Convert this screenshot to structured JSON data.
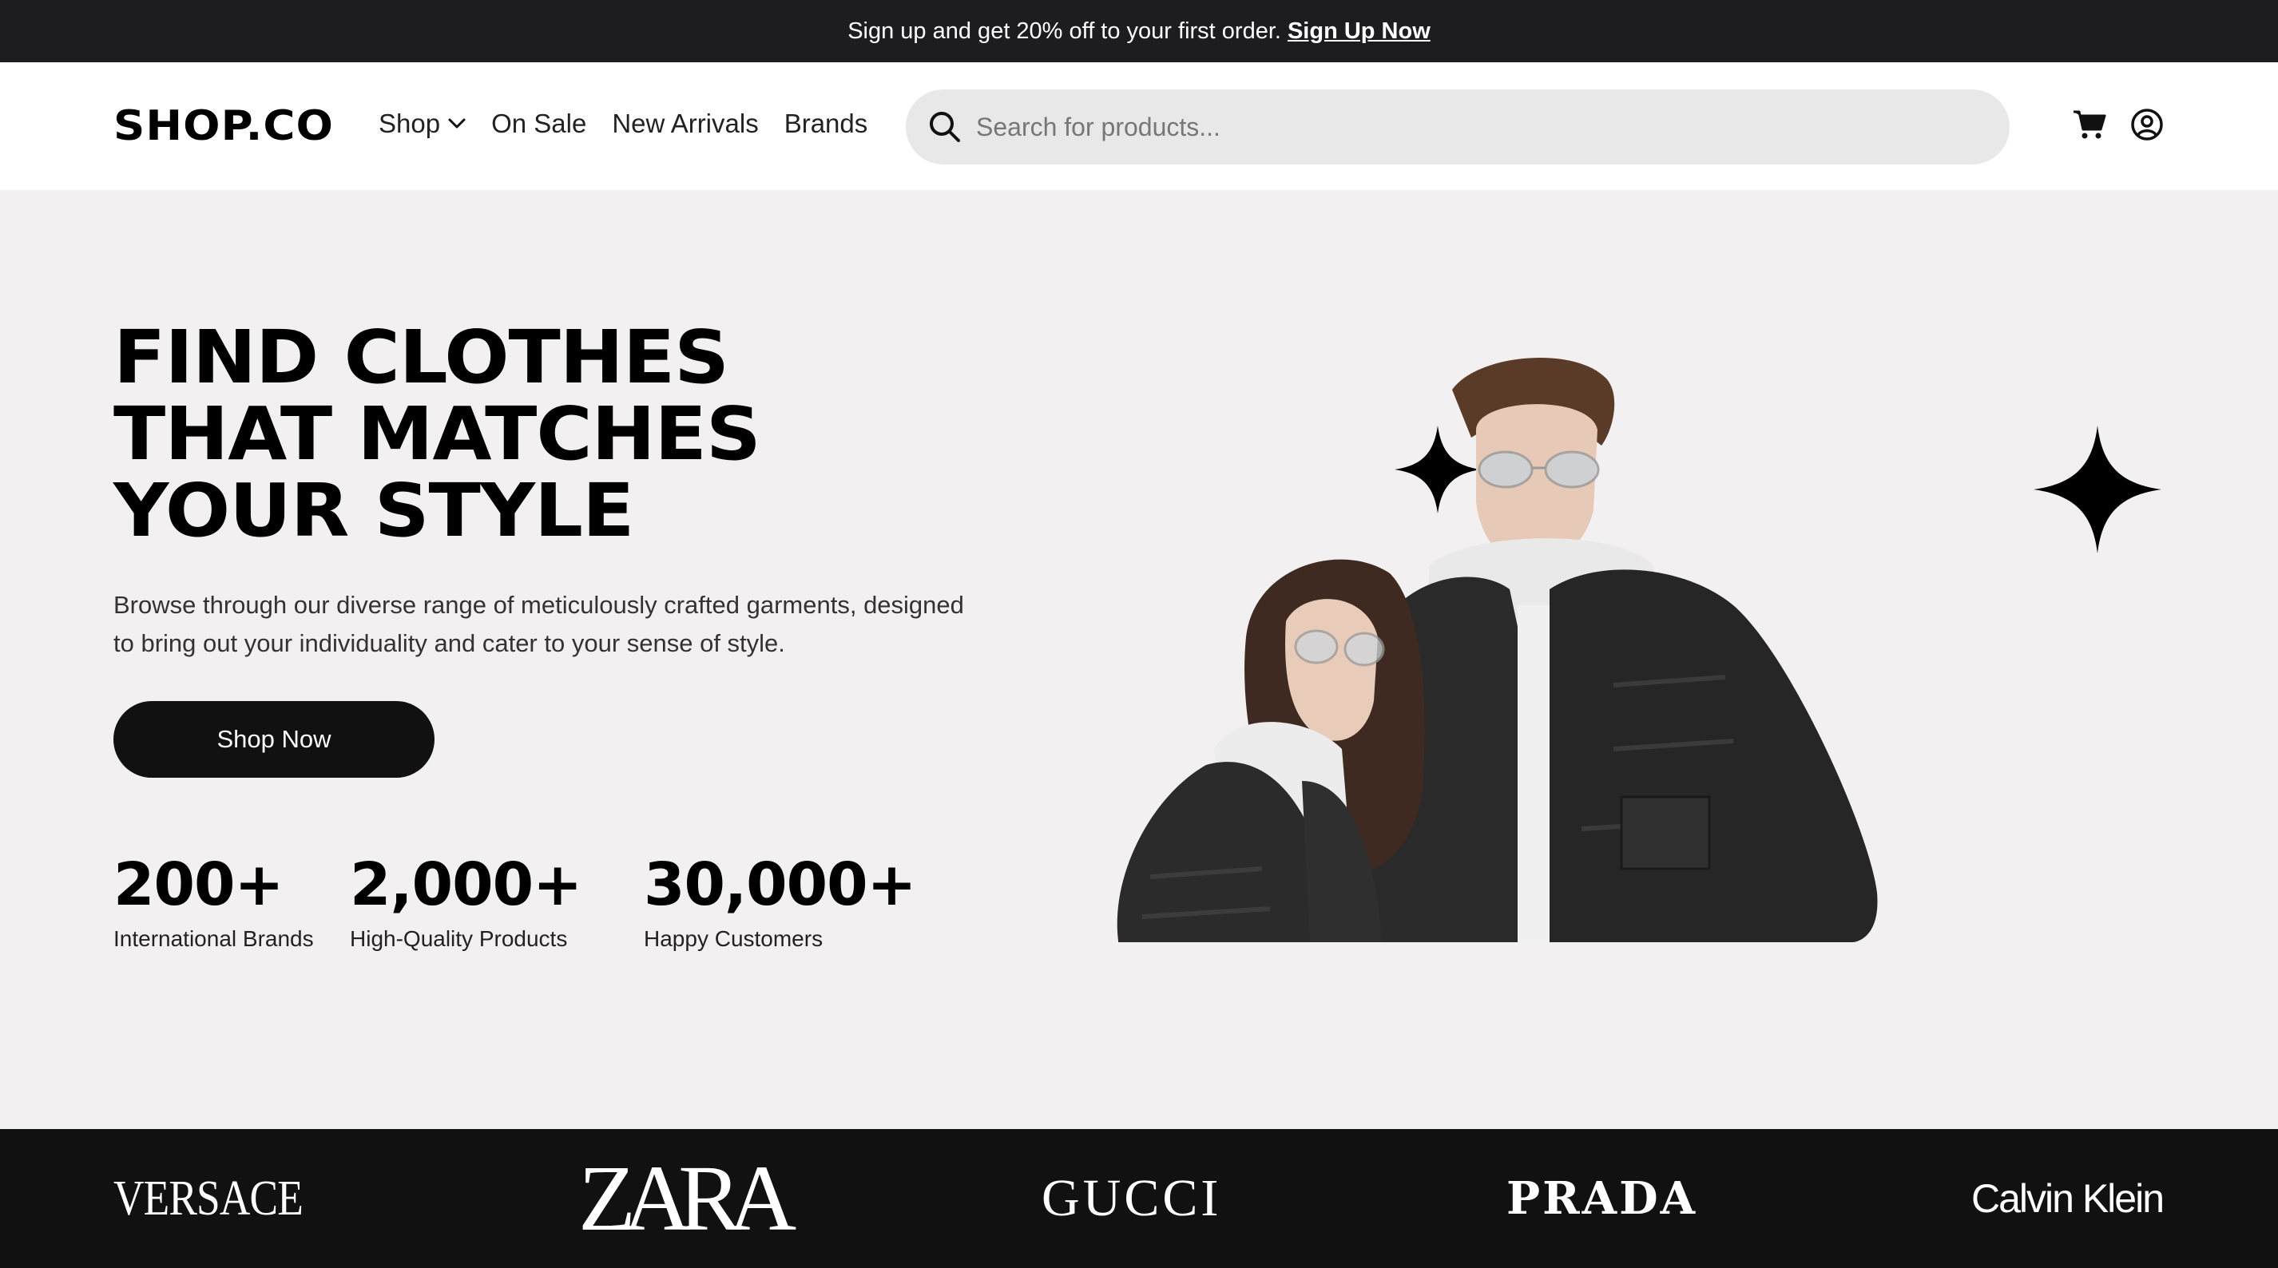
{
  "promo": {
    "text": "Sign up and get 20% off to your first order.",
    "link": "Sign Up Now"
  },
  "header": {
    "logo": "SHOP.CO",
    "nav": [
      {
        "label": "Shop",
        "has_dropdown": true
      },
      {
        "label": "On Sale"
      },
      {
        "label": "New Arrivals"
      },
      {
        "label": "Brands"
      }
    ],
    "search_placeholder": "Search for products...",
    "icons": [
      "search-icon",
      "cart-icon",
      "user-account-icon"
    ]
  },
  "hero": {
    "headline": [
      "FIND CLOTHES",
      "THAT MATCHES",
      "YOUR STYLE"
    ],
    "description_line1": "Browse through our diverse range of meticulously crafted garments, designed",
    "description_line2": "to bring out your individuality and cater to your sense of style.",
    "cta": "Shop Now",
    "stats": [
      {
        "value": "200+",
        "label": "International Brands"
      },
      {
        "value": "2,000+",
        "label": "High-Quality Products"
      },
      {
        "value": "30,000+",
        "label": "Happy Customers"
      }
    ]
  },
  "brands": [
    "VERSACE",
    "ZARA",
    "GUCCI",
    "PRADA",
    "Calvin Klein"
  ],
  "colors": {
    "promo_bg": "#1d1d1f",
    "hero_bg": "#f2f0f1",
    "button_bg": "#111111",
    "search_bg": "#e8e8e8",
    "brand_strip_bg": "#111111"
  }
}
